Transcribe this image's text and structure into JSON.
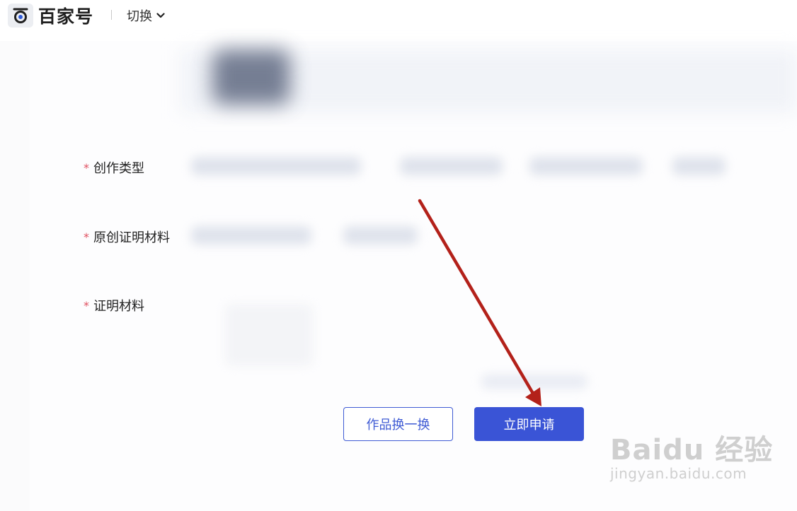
{
  "header": {
    "brand": "百家号",
    "switch_label": "切换"
  },
  "form": {
    "fields": [
      {
        "label": "创作类型",
        "required_mark": "*"
      },
      {
        "label": "原创证明材料",
        "required_mark": "*"
      },
      {
        "label": "证明材料",
        "required_mark": "*"
      }
    ]
  },
  "actions": {
    "swap_label": "作品换一换",
    "apply_label": "立即申请"
  },
  "watermark": {
    "main": "Baidu 经验",
    "sub": "jingyan.baidu.com"
  },
  "colors": {
    "primary": "#3a54d6",
    "required": "#e04f5f",
    "arrow": "#b3211a"
  }
}
